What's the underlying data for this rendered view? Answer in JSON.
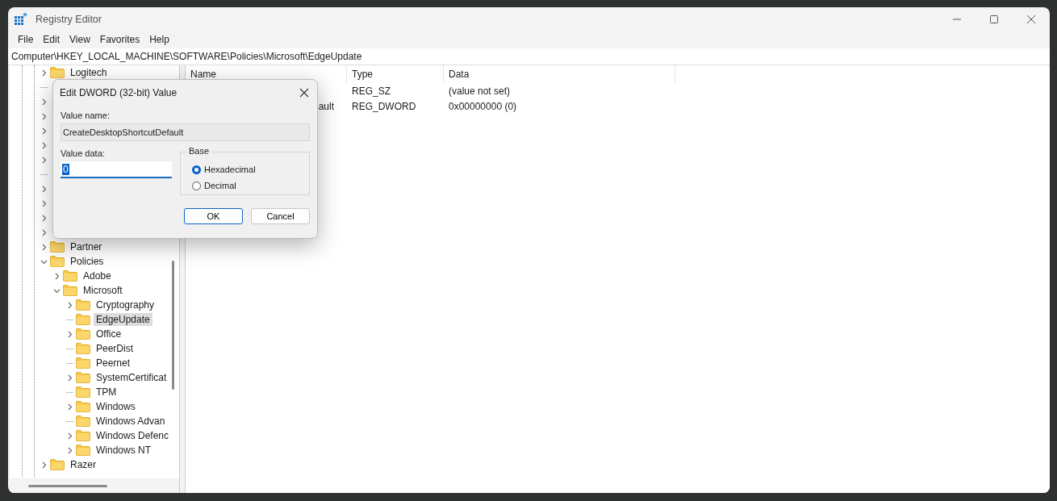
{
  "window": {
    "title": "Registry Editor"
  },
  "menu": [
    "File",
    "Edit",
    "View",
    "Favorites",
    "Help"
  ],
  "address": "Computer\\HKEY_LOCAL_MACHINE\\SOFTWARE\\Policies\\Microsoft\\EdgeUpdate",
  "tree": {
    "items": [
      {
        "label": "Logitech",
        "has_children": true,
        "expanded": false,
        "selected": false
      },
      {
        "has_children": false
      },
      {
        "has_children": true
      },
      {
        "has_children": true
      },
      {
        "has_children": true
      },
      {
        "has_children": true
      },
      {
        "has_children": true
      },
      {
        "has_children": false
      },
      {
        "has_children": true
      },
      {
        "has_children": true
      },
      {
        "has_children": true
      },
      {
        "has_children": true
      },
      {
        "label": "Partner",
        "has_children": true,
        "expanded": false,
        "selected": false
      },
      {
        "label": "Policies",
        "has_children": true,
        "expanded": true,
        "selected": false,
        "children": [
          {
            "label": "Adobe",
            "has_children": true,
            "expanded": false,
            "selected": false
          },
          {
            "label": "Microsoft",
            "has_children": true,
            "expanded": true,
            "selected": false,
            "children": [
              {
                "label": "Cryptography",
                "has_children": true,
                "expanded": false,
                "selected": false
              },
              {
                "label": "EdgeUpdate",
                "has_children": false,
                "selected": true
              },
              {
                "label": "Office",
                "has_children": true,
                "expanded": false,
                "selected": false
              },
              {
                "label": "PeerDist",
                "has_children": false,
                "selected": false
              },
              {
                "label": "Peernet",
                "has_children": false,
                "selected": false
              },
              {
                "label": "SystemCertificat",
                "has_children": true,
                "expanded": false,
                "selected": false
              },
              {
                "label": "TPM",
                "has_children": false,
                "selected": false
              },
              {
                "label": "Windows",
                "has_children": true,
                "expanded": false,
                "selected": false
              },
              {
                "label": "Windows Advan",
                "has_children": false,
                "selected": false
              },
              {
                "label": "Windows Defenc",
                "has_children": true,
                "expanded": false,
                "selected": false
              },
              {
                "label": "Windows NT",
                "has_children": true,
                "expanded": false,
                "selected": false
              }
            ]
          }
        ]
      },
      {
        "label": "Razer",
        "has_children": true,
        "expanded": false,
        "selected": false
      }
    ]
  },
  "table": {
    "columns": [
      "Name",
      "Type",
      "Data"
    ],
    "rows": [
      {
        "type": "REG_SZ",
        "data": "(value not set)"
      },
      {
        "name": "ault",
        "type": "REG_DWORD",
        "data": "0x00000000 (0)"
      }
    ]
  },
  "dialog": {
    "title": "Edit DWORD (32-bit) Value",
    "value_name_label": "Value name:",
    "value_name": "CreateDesktopShortcutDefault",
    "value_data_label": "Value data:",
    "value_data": "0",
    "base_label": "Base",
    "bases": [
      {
        "label": "Hexadecimal",
        "selected": true
      },
      {
        "label": "Decimal",
        "selected": false
      }
    ],
    "buttons": [
      {
        "label": "OK",
        "kind": "primary"
      },
      {
        "label": "Cancel",
        "kind": "secondary"
      }
    ]
  }
}
